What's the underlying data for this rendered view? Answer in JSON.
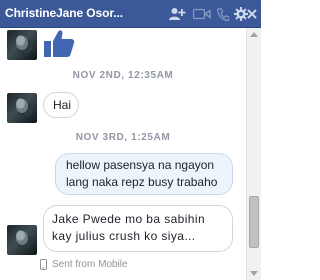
{
  "header": {
    "title": "ChristineJane Osor...",
    "icons": [
      "add-friend-icon",
      "video-call-icon",
      "phone-icon",
      "gear-icon",
      "close-icon"
    ]
  },
  "conversation": {
    "timestamps": [
      "NOV 2ND, 12:35AM",
      "NOV 3RD, 1:25AM"
    ],
    "messages": {
      "m1": "Hai",
      "m2": "hellow pasensya na ngayon lang naka repz busy trabaho",
      "m3": "Jake Pwede mo ba sabihin kay julius crush ko siya..."
    },
    "sent_from": "Sent from Mobile"
  },
  "colors": {
    "header": "#3b5998",
    "like": "#4267b2",
    "outgoing_bubble": "#eef4fc",
    "incoming_border": "#d3d6db",
    "timestamp": "#9197a3"
  }
}
